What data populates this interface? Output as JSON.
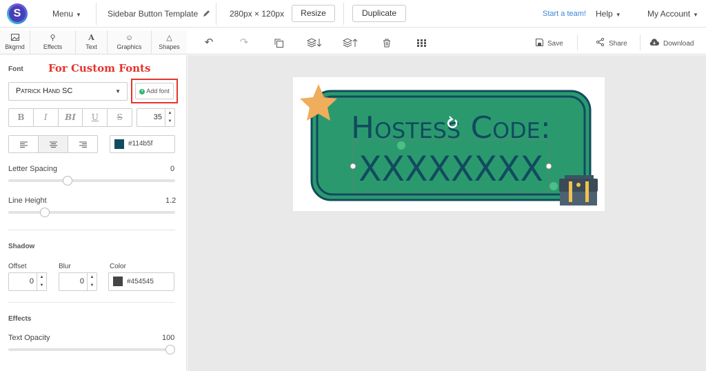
{
  "topbar": {
    "logo_letter": "S",
    "menu_label": "Menu",
    "doc_title": "Sidebar Button Template",
    "dimensions": "280px × 120px",
    "resize_label": "Resize",
    "duplicate_label": "Duplicate",
    "team_label": "Start a team!",
    "help_label": "Help",
    "account_label": "My Account"
  },
  "tool_tabs": [
    {
      "label": "Bkgrnd",
      "icon": "image-icon"
    },
    {
      "label": "Effects",
      "icon": "wand-icon"
    },
    {
      "label": "Text",
      "icon": "text-icon"
    },
    {
      "label": "Graphics",
      "icon": "smiley-icon"
    },
    {
      "label": "Shapes",
      "icon": "triangle-icon"
    }
  ],
  "actions": {
    "save_label": "Save",
    "share_label": "Share",
    "download_label": "Download"
  },
  "panel": {
    "font_heading": "Font",
    "callout": "For Custom Fonts",
    "font_name": "Patrick Hand SC",
    "add_font_label": "Add font",
    "format_buttons": [
      "B",
      "I",
      "BI",
      "U",
      "S"
    ],
    "font_size": "35",
    "text_color_hex": "#114b5f",
    "letter_spacing_label": "Letter Spacing",
    "letter_spacing_value": "0",
    "letter_spacing_fraction": 0.345,
    "line_height_label": "Line Height",
    "line_height_value": "1.2",
    "line_height_fraction": 0.2,
    "shadow_heading": "Shadow",
    "offset_label": "Offset",
    "offset_value": "0",
    "blur_label": "Blur",
    "blur_value": "0",
    "shadow_color_label": "Color",
    "shadow_color_hex": "#454545",
    "effects_heading": "Effects",
    "opacity_label": "Text Opacity",
    "opacity_value": "100",
    "opacity_fraction": 1.0
  },
  "canvas": {
    "headline": "Hostess Code:",
    "code": "XXXXXXXX",
    "badge_color": "#2a9a6e",
    "outline_color": "#114b5f",
    "star_color": "#f0ad5c"
  }
}
